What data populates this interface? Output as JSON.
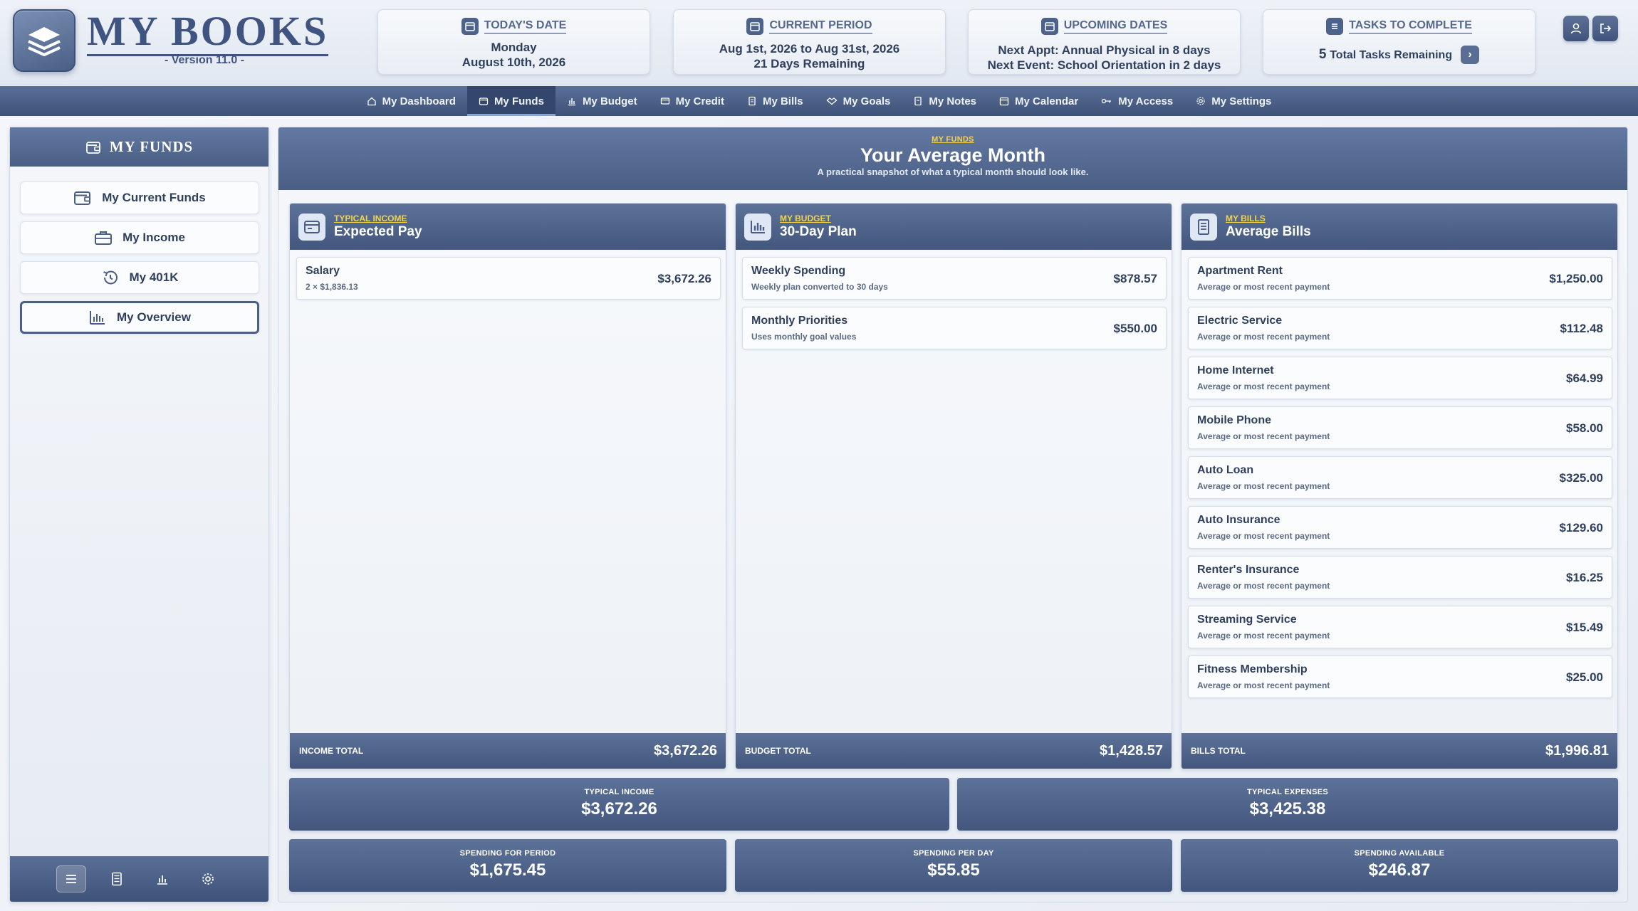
{
  "app": {
    "title": "MY BOOKS",
    "version": "- Version 11.0 -"
  },
  "header_cards": {
    "today": {
      "title": "TODAY'S DATE",
      "line1": "Monday",
      "line2": "August 10th, 2026"
    },
    "period": {
      "title": "CURRENT PERIOD",
      "line1": "Aug 1st, 2026 to Aug 31st, 2026",
      "line2": "21 Days Remaining"
    },
    "upcoming": {
      "title": "UPCOMING DATES",
      "line1": "Next Appt: Annual Physical in 8 days",
      "line2": "Next Event: School Orientation in 2 days"
    },
    "tasks": {
      "title": "TASKS TO COMPLETE",
      "count": "5",
      "text": "Total Tasks Remaining",
      "go": "›"
    }
  },
  "nav": [
    {
      "label": "My Dashboard",
      "icon": "home-icon"
    },
    {
      "label": "My Funds",
      "icon": "wallet-icon"
    },
    {
      "label": "My Budget",
      "icon": "chart-icon"
    },
    {
      "label": "My Credit",
      "icon": "card-icon"
    },
    {
      "label": "My Bills",
      "icon": "receipt-icon"
    },
    {
      "label": "My Goals",
      "icon": "handshake-icon"
    },
    {
      "label": "My Notes",
      "icon": "note-icon"
    },
    {
      "label": "My Calendar",
      "icon": "calendar-icon"
    },
    {
      "label": "My Access",
      "icon": "key-icon"
    },
    {
      "label": "My Settings",
      "icon": "gear-icon"
    }
  ],
  "sidebar": {
    "title": "MY FUNDS",
    "items": [
      {
        "label": "My Current Funds",
        "icon": "wallet-icon"
      },
      {
        "label": "My Income",
        "icon": "briefcase-icon"
      },
      {
        "label": "My 401K",
        "icon": "history-icon"
      },
      {
        "label": "My Overview",
        "icon": "bar-chart-icon"
      }
    ]
  },
  "main": {
    "eyebrow": "MY FUNDS",
    "title": "Your Average Month",
    "subtitle": "A practical snapshot of what a typical month should look like."
  },
  "income": {
    "eyebrow": "TYPICAL INCOME",
    "title": "Expected Pay",
    "rows": [
      {
        "name": "Salary",
        "sub": "2 × $1,836.13",
        "amount": "$3,672.26"
      }
    ],
    "total_label": "INCOME TOTAL",
    "total": "$3,672.26"
  },
  "budget": {
    "eyebrow": "MY BUDGET",
    "title": "30-Day Plan",
    "rows": [
      {
        "name": "Weekly Spending",
        "sub": "Weekly plan converted to 30 days",
        "amount": "$878.57"
      },
      {
        "name": "Monthly Priorities",
        "sub": "Uses monthly goal values",
        "amount": "$550.00"
      }
    ],
    "total_label": "BUDGET TOTAL",
    "total": "$1,428.57"
  },
  "bills": {
    "eyebrow": "MY BILLS",
    "title": "Average Bills",
    "rows": [
      {
        "name": "Apartment Rent",
        "sub": "Average or most recent payment",
        "amount": "$1,250.00"
      },
      {
        "name": "Electric Service",
        "sub": "Average or most recent payment",
        "amount": "$112.48"
      },
      {
        "name": "Home Internet",
        "sub": "Average or most recent payment",
        "amount": "$64.99"
      },
      {
        "name": "Mobile Phone",
        "sub": "Average or most recent payment",
        "amount": "$58.00"
      },
      {
        "name": "Auto Loan",
        "sub": "Average or most recent payment",
        "amount": "$325.00"
      },
      {
        "name": "Auto Insurance",
        "sub": "Average or most recent payment",
        "amount": "$129.60"
      },
      {
        "name": "Renter's Insurance",
        "sub": "Average or most recent payment",
        "amount": "$16.25"
      },
      {
        "name": "Streaming Service",
        "sub": "Average or most recent payment",
        "amount": "$15.49"
      },
      {
        "name": "Fitness Membership",
        "sub": "Average or most recent payment",
        "amount": "$25.00"
      }
    ],
    "total_label": "BILLS TOTAL",
    "total": "$1,996.81"
  },
  "summary": {
    "typical_income": {
      "label": "TYPICAL INCOME",
      "value": "$3,672.26"
    },
    "typical_expenses": {
      "label": "TYPICAL EXPENSES",
      "value": "$3,425.38"
    },
    "spending_period": {
      "label": "SPENDING FOR PERIOD",
      "value": "$1,675.45"
    },
    "spending_day": {
      "label": "SPENDING PER DAY",
      "value": "$55.85"
    },
    "spending_available": {
      "label": "SPENDING AVAILABLE",
      "value": "$246.87"
    }
  },
  "colors": {
    "accent": "#4a5e85",
    "highlight": "#f3d24a",
    "text": "#2f3f5e"
  }
}
